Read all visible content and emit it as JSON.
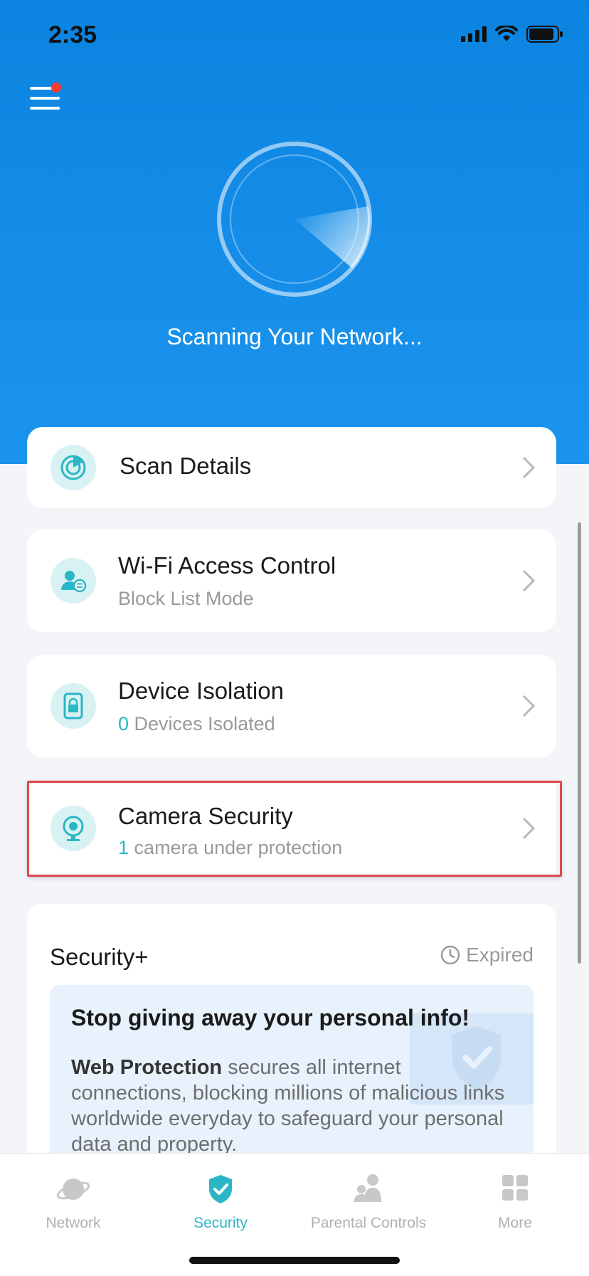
{
  "status_bar": {
    "time": "2:35"
  },
  "hero": {
    "scan_text": "Scanning Your Network..."
  },
  "cards": {
    "scan_details": {
      "title": "Scan Details"
    },
    "wifi_access": {
      "title": "Wi-Fi Access Control",
      "subtitle": "Block List Mode"
    },
    "device_isolation": {
      "title": "Device Isolation",
      "count": "0",
      "subtitle": "Devices Isolated"
    },
    "camera_security": {
      "title": "Camera Security",
      "count": "1",
      "subtitle": "camera under protection"
    }
  },
  "security_plus": {
    "title": "Security+",
    "status": "Expired",
    "promo_title": "Stop giving away your personal info!",
    "promo_bold": "Web Protection",
    "promo_text": " secures all internet connections, blocking millions of malicious links worldwide everyday to safeguard your personal data and property."
  },
  "tabs": [
    {
      "label": "Network",
      "icon": "planet-icon",
      "active": false
    },
    {
      "label": "Security",
      "icon": "shield-check-icon",
      "active": true
    },
    {
      "label": "Parental Controls",
      "icon": "family-icon",
      "active": false
    },
    {
      "label": "More",
      "icon": "grid-icon",
      "active": false
    }
  ],
  "colors": {
    "hero": "#168ee9",
    "accent": "#2bb6c6",
    "highlight": "#e0474c"
  }
}
